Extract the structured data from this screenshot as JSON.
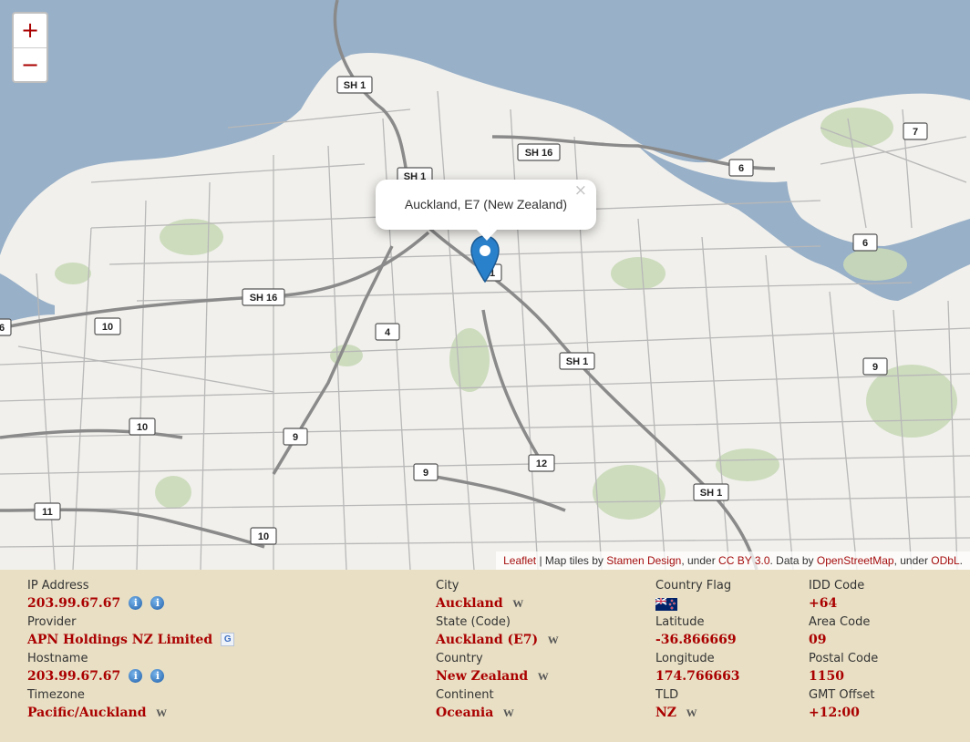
{
  "map": {
    "zoom_in": "+",
    "zoom_out": "−",
    "popup_text": "Auckland, E7 (New Zealand)",
    "popup_close": "×",
    "route_labels": {
      "sh1_a": "SH 1",
      "sh1_b": "SH 1",
      "sh1_c": "SH 1",
      "sh1_d": "SH 1",
      "sh16_a": "SH 16",
      "sh16_b": "SH 16",
      "r6_a": "6",
      "r6_b": "6",
      "r6_c": "6",
      "r7": "7",
      "r10_a": "10",
      "r10_b": "10",
      "r10_c": "10",
      "r4": "4",
      "r9_a": "9",
      "r9_b": "9",
      "r9_c": "9",
      "r12": "12",
      "r11": "11",
      "r1": "1"
    },
    "attribution": {
      "leaflet": "Leaflet",
      "t1": " | Map tiles by ",
      "stamen": "Stamen Design",
      "t2": ", under ",
      "ccby": "CC BY 3.0",
      "t3": ". Data by ",
      "osm": "OpenStreetMap",
      "t4": ", under ",
      "odbl": "ODbL",
      "t5": "."
    },
    "colors": {
      "water": "#98b0c8",
      "land": "#f1f0ec",
      "park": "#c9d9b8",
      "road": "#8a8a8a",
      "marker": "#2a81cb"
    }
  },
  "info": {
    "ip": {
      "label": "IP Address",
      "value": "203.99.67.67"
    },
    "provider": {
      "label": "Provider",
      "value": "APN Holdings NZ Limited"
    },
    "hostname": {
      "label": "Hostname",
      "value": "203.99.67.67"
    },
    "timezone": {
      "label": "Timezone",
      "value": "Pacific/Auckland"
    },
    "city": {
      "label": "City",
      "value": "Auckland"
    },
    "state": {
      "label": "State (Code)",
      "value": "Auckland (E7)"
    },
    "country": {
      "label": "Country",
      "value": "New Zealand"
    },
    "continent": {
      "label": "Continent",
      "value": "Oceania"
    },
    "flag": {
      "label": "Country Flag"
    },
    "latitude": {
      "label": "Latitude",
      "value": "-36.866669"
    },
    "longitude": {
      "label": "Longitude",
      "value": "174.766663"
    },
    "tld": {
      "label": "TLD",
      "value": "NZ"
    },
    "idd": {
      "label": "IDD Code",
      "value": "+64"
    },
    "area": {
      "label": "Area Code",
      "value": "09"
    },
    "postal": {
      "label": "Postal Code",
      "value": "1150"
    },
    "gmt": {
      "label": "GMT Offset",
      "value": "+12:00"
    },
    "icons": {
      "info": "i",
      "wiki": "W",
      "google": "G"
    }
  }
}
